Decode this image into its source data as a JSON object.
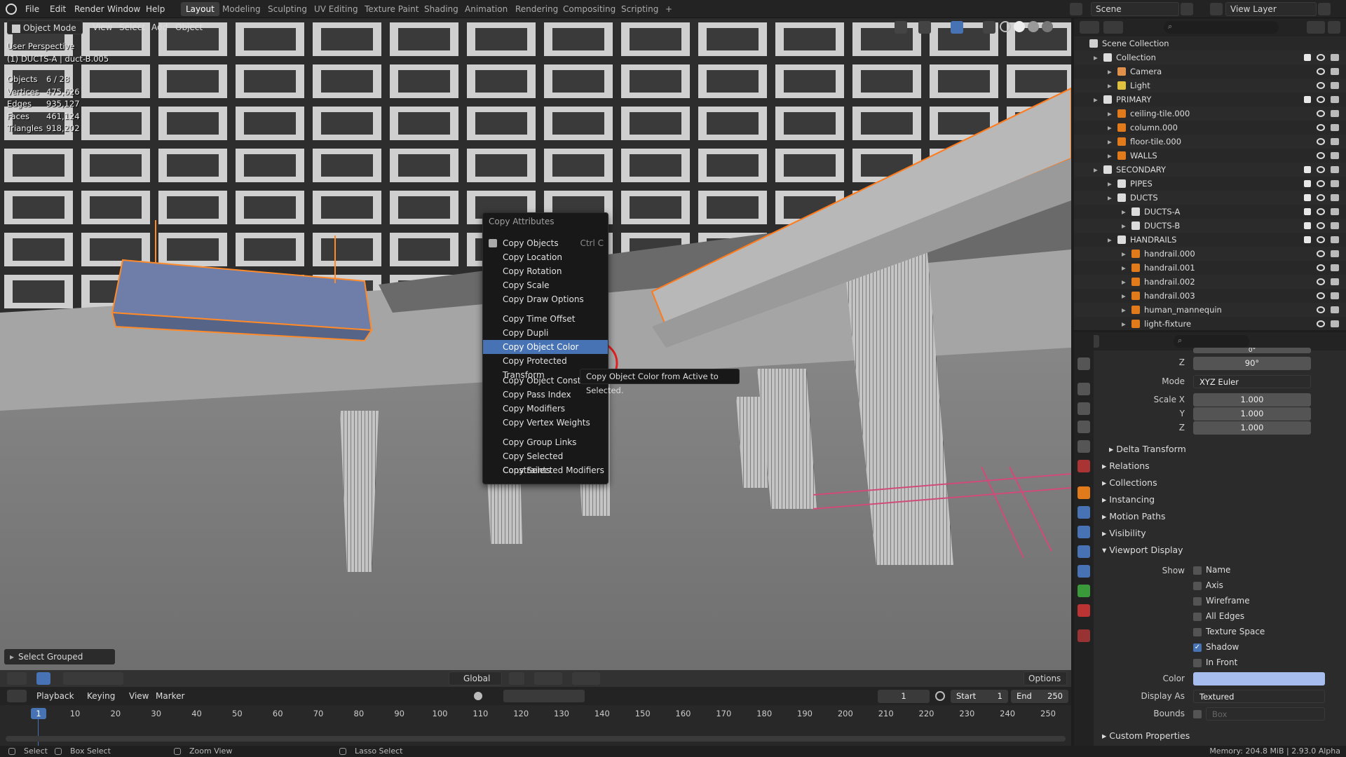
{
  "topbar": {
    "menus": [
      "File",
      "Edit",
      "Render",
      "Window",
      "Help"
    ],
    "workspaces": [
      "Layout",
      "Modeling",
      "Sculpting",
      "UV Editing",
      "Texture Paint",
      "Shading",
      "Animation",
      "Rendering",
      "Compositing",
      "Scripting",
      "+"
    ],
    "active_workspace": "Layout",
    "scene": "Scene",
    "view_layer": "View Layer"
  },
  "viewport": {
    "mode": "Object Mode",
    "menus": [
      "View",
      "Select",
      "Add",
      "Object"
    ],
    "perspective": "User Perspective",
    "active_object": "(1) DUCTS-A | duct-B.005",
    "stats": [
      {
        "label": "Objects",
        "value": "6 / 28"
      },
      {
        "label": "Vertices",
        "value": "475,626"
      },
      {
        "label": "Edges",
        "value": "935,127"
      },
      {
        "label": "Faces",
        "value": "461,124"
      },
      {
        "label": "Triangles",
        "value": "918,202"
      }
    ],
    "last_operator": "Select Grouped",
    "transform_orientation": "Global",
    "options_label": "Options"
  },
  "context_menu": {
    "title": "Copy Attributes",
    "groups": [
      [
        {
          "label": "Copy Objects",
          "shortcut": "Ctrl C"
        },
        {
          "label": "Copy Location"
        },
        {
          "label": "Copy Rotation"
        },
        {
          "label": "Copy Scale"
        },
        {
          "label": "Copy Draw Options"
        }
      ],
      [
        {
          "label": "Copy Time Offset"
        },
        {
          "label": "Copy Dupli"
        },
        {
          "label": "Copy Object Color",
          "highlighted": true
        },
        {
          "label": "Copy Protected Transform"
        }
      ],
      [
        {
          "label": "Copy Object Constrai"
        },
        {
          "label": "Copy Pass Index"
        },
        {
          "label": "Copy Modifiers"
        },
        {
          "label": "Copy Vertex Weights"
        }
      ],
      [
        {
          "label": "Copy Group Links"
        },
        {
          "label": "Copy Selected Constraints"
        },
        {
          "label": "Copy Selected Modifiers"
        }
      ]
    ],
    "tooltip": "Copy Object Color from Active to Selected."
  },
  "outliner": {
    "rows": [
      {
        "label": "Scene Collection",
        "indent": 0,
        "kind": "scene"
      },
      {
        "label": "Collection",
        "indent": 1,
        "kind": "collection",
        "check": true
      },
      {
        "label": "Camera",
        "indent": 2,
        "kind": "camera"
      },
      {
        "label": "Light",
        "indent": 2,
        "kind": "light"
      },
      {
        "label": "PRIMARY",
        "indent": 1,
        "kind": "collection",
        "check": true
      },
      {
        "label": "ceiling-tile.000",
        "indent": 2,
        "kind": "mesh"
      },
      {
        "label": "column.000",
        "indent": 2,
        "kind": "mesh"
      },
      {
        "label": "floor-tile.000",
        "indent": 2,
        "kind": "mesh"
      },
      {
        "label": "WALLS",
        "indent": 2,
        "kind": "mesh"
      },
      {
        "label": "SECONDARY",
        "indent": 1,
        "kind": "collection",
        "check": true
      },
      {
        "label": "PIPES",
        "indent": 2,
        "kind": "collection",
        "check": true
      },
      {
        "label": "DUCTS",
        "indent": 2,
        "kind": "collection",
        "check": true
      },
      {
        "label": "DUCTS-A",
        "indent": 3,
        "kind": "collection",
        "check": true
      },
      {
        "label": "DUCTS-B",
        "indent": 3,
        "kind": "collection",
        "check": true
      },
      {
        "label": "HANDRAILS",
        "indent": 2,
        "kind": "collection",
        "check": true
      },
      {
        "label": "handrail.000",
        "indent": 3,
        "kind": "mesh"
      },
      {
        "label": "handrail.001",
        "indent": 3,
        "kind": "mesh"
      },
      {
        "label": "handrail.002",
        "indent": 3,
        "kind": "mesh"
      },
      {
        "label": "handrail.003",
        "indent": 3,
        "kind": "mesh"
      },
      {
        "label": "human_mannequin",
        "indent": 3,
        "kind": "mesh"
      },
      {
        "label": "light-fixture",
        "indent": 3,
        "kind": "mesh"
      }
    ]
  },
  "properties": {
    "rot_y": "0°",
    "rot_z": "90°",
    "mode_label": "Mode",
    "mode_value": "XYZ Euler",
    "scale_label": "Scale X",
    "scale_x": "1.000",
    "scale_y": "1.000",
    "scale_z": "1.000",
    "axis_y": "Y",
    "axis_z": "Z",
    "panels": [
      "Delta Transform",
      "Relations",
      "Collections",
      "Instancing",
      "Motion Paths",
      "Visibility",
      "Viewport Display"
    ],
    "show_label": "Show",
    "show_options": [
      {
        "label": "Name",
        "checked": false
      },
      {
        "label": "Axis",
        "checked": false
      },
      {
        "label": "Wireframe",
        "checked": false
      },
      {
        "label": "All Edges",
        "checked": false
      },
      {
        "label": "Texture Space",
        "checked": false
      },
      {
        "label": "Shadow",
        "checked": true
      },
      {
        "label": "In Front",
        "checked": false
      }
    ],
    "color_label": "Color",
    "color_value": "#a7bdf0",
    "display_as_label": "Display As",
    "display_as_value": "Textured",
    "bounds_label": "Bounds",
    "bounds_value": "Box",
    "custom_props": "Custom Properties"
  },
  "timeline": {
    "menus": [
      "Playback",
      "Keying",
      "View",
      "Marker"
    ],
    "current_frame": "1",
    "start_label": "Start",
    "start": "1",
    "end_label": "End",
    "end": "250",
    "ticks": [
      "1",
      "10",
      "20",
      "30",
      "40",
      "50",
      "60",
      "70",
      "80",
      "90",
      "100",
      "110",
      "120",
      "130",
      "140",
      "150",
      "160",
      "170",
      "180",
      "190",
      "200",
      "210",
      "220",
      "230",
      "240",
      "250"
    ]
  },
  "statusbar": {
    "left": [
      "Select",
      "Box Select",
      "Zoom View",
      "Lasso Select"
    ],
    "right": "Memory: 204.8 MiB | 2.93.0 Alpha"
  },
  "colors": {
    "accent": "#4772b3",
    "selection": "#ff7a1a",
    "cursor_ring": "#e02020"
  }
}
